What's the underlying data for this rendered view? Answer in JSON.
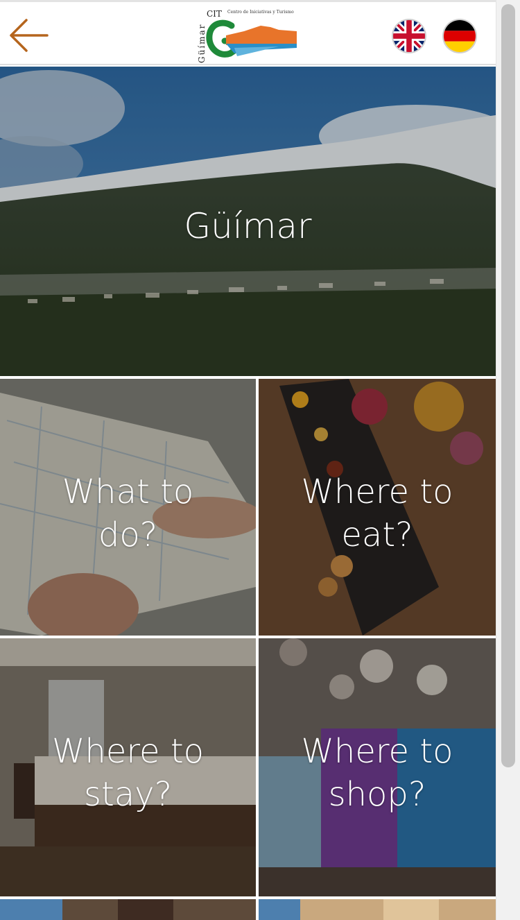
{
  "header": {
    "back_icon": "arrow-left-icon",
    "logo": {
      "vertical_text": "Güímar",
      "cit_text": "CIT",
      "subtitle": "Centro de Iniciativas y Turismo"
    },
    "languages": [
      {
        "code": "en",
        "icon": "uk-flag-icon"
      },
      {
        "code": "de",
        "icon": "germany-flag-icon"
      }
    ],
    "accent_color": "#b5651d"
  },
  "hero": {
    "title": "Güímar"
  },
  "tiles": [
    {
      "id": "what-to-do",
      "title_line1": "What to",
      "title_line2": "do?"
    },
    {
      "id": "where-to-eat",
      "title_line1": "Where to",
      "title_line2": "eat?"
    },
    {
      "id": "where-to-stay",
      "title_line1": "Where to",
      "title_line2": "stay?"
    },
    {
      "id": "where-to-shop",
      "title_line1": "Where to",
      "title_line2": "shop?"
    }
  ]
}
